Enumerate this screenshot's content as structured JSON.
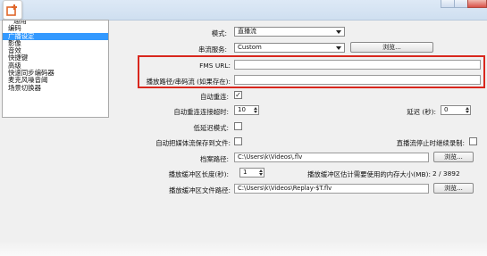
{
  "sidebar": {
    "items": [
      "通用",
      "编码",
      "广播设定",
      "影像",
      "音效",
      "快捷键",
      "高级",
      "快速同步编码器",
      "麦克风噪音阈",
      "场景切换器"
    ],
    "selected": "广播设定"
  },
  "form": {
    "mode_label": "模式:",
    "mode_value": "直播流",
    "service_label": "串流服务:",
    "service_value": "Custom",
    "browse_label": "浏览...",
    "fms_url_label": "FMS URL:",
    "fms_url_value": "",
    "play_path_label": "播放路径/串码流 (如果存在):",
    "play_path_value": "",
    "auto_reconnect_label": "自动重连:",
    "auto_reconnect_checked": true,
    "auto_reconnect_timeout_label": "自动重连连接超时:",
    "auto_reconnect_timeout_value": "10",
    "delay_label": "延迟 (秒):",
    "delay_value": "0",
    "low_latency_label": "低延迟模式:",
    "low_latency_checked": false,
    "auto_save_label": "自动把媒体流保存到文件:",
    "auto_save_checked": false,
    "keep_recording_label": "直播流停止时继续录制:",
    "keep_recording_checked": false,
    "file_path_label": "档案路径:",
    "file_path_value": "C:\\Users\\k\\Videos\\.flv",
    "replay_length_label": "播放缓冲区长度(秒):",
    "replay_length_value": "1",
    "replay_memory_label": "播放缓冲区估计需要使用的内存大小(MB):",
    "replay_memory_value": "2 / 3892",
    "replay_file_path_label": "播放缓冲区文件路径:",
    "replay_file_path_value": "C:\\Users\\k\\Videos\\Replay-$T.flv",
    "check_mark": "✓"
  },
  "colors": {
    "highlight_box": "#d9271d",
    "selected_item": "#3399ff"
  }
}
